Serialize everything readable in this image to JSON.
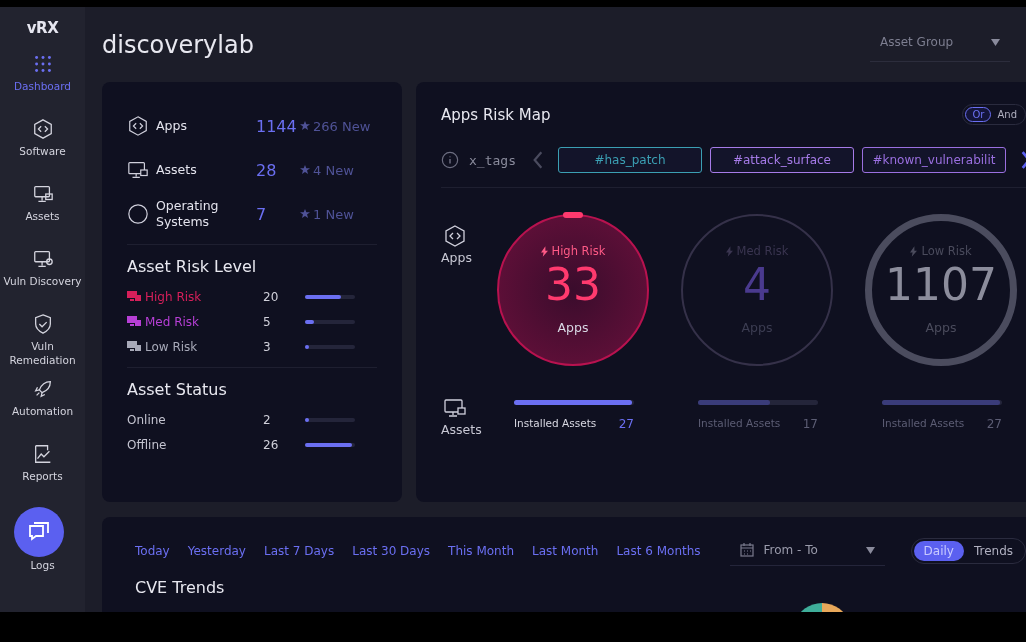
{
  "brand": {
    "logo": "vRX"
  },
  "sidebar": {
    "items": [
      {
        "kind": "grid",
        "label": "Dashboard",
        "selected": true
      },
      {
        "kind": "code",
        "label": "Software",
        "selected": false
      },
      {
        "kind": "monitor",
        "label": "Assets",
        "selected": false
      },
      {
        "kind": "monitor-search",
        "label": "Vuln Discovery",
        "selected": false
      },
      {
        "kind": "shield",
        "label": "Vuln Remediation",
        "selected": false
      },
      {
        "kind": "rocket",
        "label": "Automation",
        "selected": false
      },
      {
        "kind": "report",
        "label": "Reports",
        "selected": false
      },
      {
        "kind": "logs",
        "label": "Logs",
        "selected": false
      }
    ]
  },
  "header": {
    "title": "discoverylab",
    "asset_group": {
      "placeholder": "Asset Group"
    }
  },
  "summary": [
    {
      "kind": "code",
      "label": "Apps",
      "count": "1144",
      "new": "266 New"
    },
    {
      "kind": "monitor",
      "label": "Assets",
      "count": "28",
      "new": "4 New"
    },
    {
      "kind": "os",
      "label": "Operating Systems",
      "count": "7",
      "new": "1 New"
    }
  ],
  "asset_risk_level": {
    "title": "Asset Risk Level",
    "rows": [
      {
        "label": "High Risk",
        "count": "20",
        "level": 0.72,
        "color": "#d61f5a"
      },
      {
        "label": "Med Risk",
        "count": "5",
        "level": 0.18,
        "color": "#b73fd6"
      },
      {
        "label": "Low Risk",
        "count": "3",
        "level": 0.08,
        "color": "#a7a9b8"
      }
    ]
  },
  "asset_status": {
    "title": "Asset Status",
    "rows": [
      {
        "label": "Online",
        "count": "2",
        "level": 0.06
      },
      {
        "label": "Offline",
        "count": "26",
        "level": 0.93
      }
    ]
  },
  "risk_map": {
    "title": "Apps Risk Map",
    "logic_toggle": [
      {
        "label": "Or",
        "selected": true
      },
      {
        "label": "And",
        "selected": false
      }
    ],
    "tag_filter": {
      "label": "x_tags",
      "tags": [
        {
          "label": "#has_patch",
          "color": "#3b9fb3"
        },
        {
          "label": "#attack_surface",
          "color": "#a67be8"
        },
        {
          "label": "#known_vulnerabilit",
          "color": "#9a6fe0"
        }
      ]
    },
    "apps_label": "Apps",
    "assets_label": "Assets",
    "risk_groups": [
      {
        "kind": "high",
        "label": "High Risk",
        "count": "33",
        "unit": "Apps",
        "selected": true,
        "installed_label": "Installed Assets",
        "installed_count": "27",
        "level": 0.98
      },
      {
        "kind": "med",
        "label": "Med Risk",
        "count": "4",
        "unit": "Apps",
        "selected": false,
        "installed_label": "Installed Assets",
        "installed_count": "17",
        "level": 0.6
      },
      {
        "kind": "low",
        "label": "Low Risk",
        "count": "1107",
        "unit": "Apps",
        "selected": false,
        "installed_label": "Installed Assets",
        "installed_count": "27",
        "level": 0.98
      }
    ]
  },
  "cve": {
    "ranges": [
      "Today",
      "Yesterday",
      "Last 7 Days",
      "Last 30 Days",
      "This Month",
      "Last Month",
      "Last 6 Months"
    ],
    "date_range": {
      "placeholder": "From - To"
    },
    "view_toggle": [
      {
        "label": "Daily",
        "selected": true
      },
      {
        "label": "Trends",
        "selected": false
      }
    ],
    "title": "CVE Trends"
  }
}
